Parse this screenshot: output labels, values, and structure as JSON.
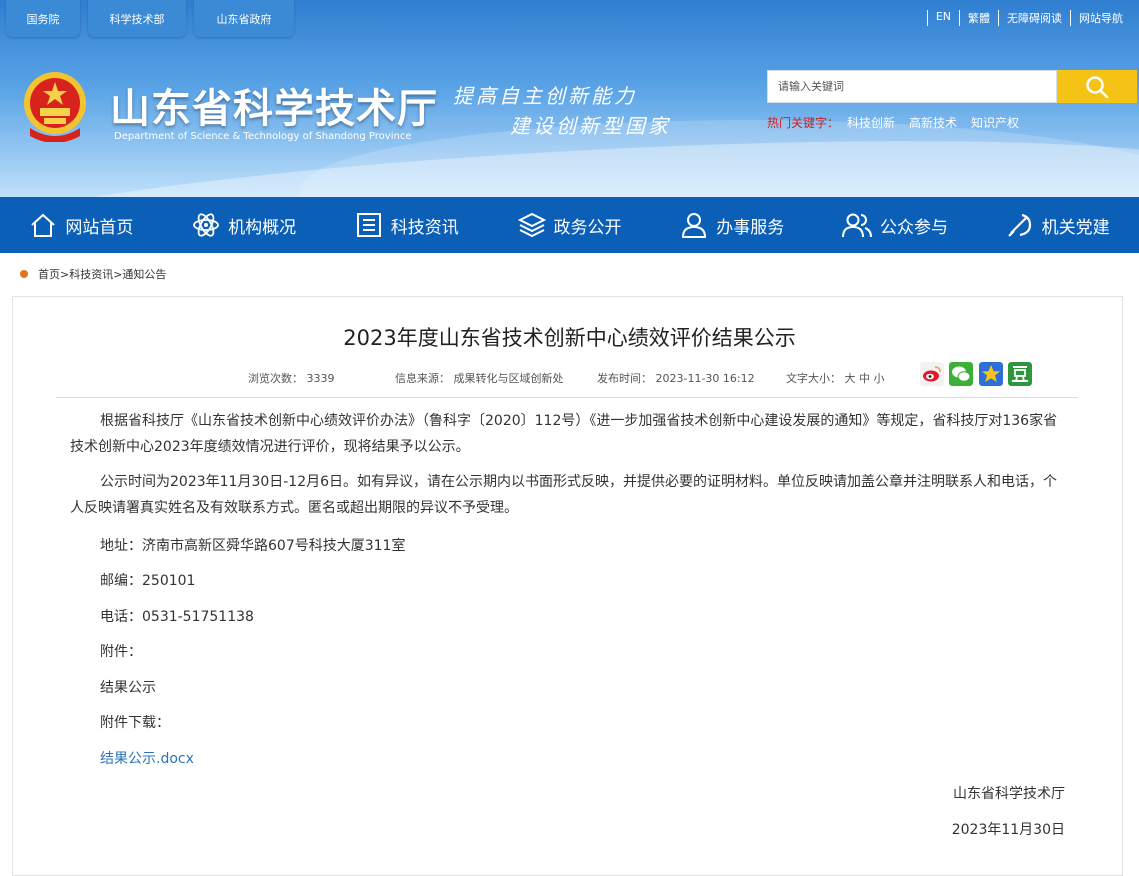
{
  "top_tabs": [
    "国务院",
    "科学技术部",
    "山东省政府"
  ],
  "top_links": [
    "EN",
    "繁體",
    "无障碍阅读",
    "网站导航"
  ],
  "site_title": "山东省科学技术厅",
  "site_subtitle": "Department of Science & Technology of Shandong Province",
  "slogan_line1": "提高自主创新能力",
  "slogan_line2": "建设创新型国家",
  "search": {
    "placeholder": "请输入关键词",
    "icon": "search-icon"
  },
  "hot_keywords": {
    "label": "热门关键字：",
    "items": [
      "科技创新",
      "高新技术",
      "知识产权"
    ]
  },
  "nav": [
    {
      "label": "网站首页",
      "icon": "home-icon"
    },
    {
      "label": "机构概况",
      "icon": "atom-icon"
    },
    {
      "label": "科技资讯",
      "icon": "news-icon"
    },
    {
      "label": "政务公开",
      "icon": "layers-icon"
    },
    {
      "label": "办事服务",
      "icon": "user-icon"
    },
    {
      "label": "公众参与",
      "icon": "people-icon"
    },
    {
      "label": "机关党建",
      "icon": "party-icon"
    }
  ],
  "breadcrumb": "首页>科技资讯>通知公告",
  "article": {
    "title": "2023年度山东省技术创新中心绩效评价结果公示",
    "views": "浏览次数：  3339",
    "source": "信息来源：  成果转化与区域创新处",
    "published": "发布时间：  2023-11-30 16:12",
    "font_size": "文字大小：  大 中 小",
    "share_icons": [
      "weibo-icon",
      "wechat-icon",
      "qzone-icon",
      "douban-icon"
    ],
    "para1": "根据省科技厅《山东省技术创新中心绩效评价办法》（鲁科字〔2020〕112号）《进一步加强省技术创新中心建设发展的通知》等规定，省科技厅对136家省技术创新中心2023年度绩效情况进行评价，现将结果予以公示。",
    "para2": "公示时间为2023年11月30日-12月6日。如有异议，请在公示期内以书面形式反映，并提供必要的证明材料。单位反映请加盖公章并注明联系人和电话，个人反映请署真实姓名及有效联系方式。匿名或超出期限的异议不予受理。",
    "address": "地址：济南市高新区舜华路607号科技大厦311室",
    "postcode": "邮编：250101",
    "phone": "电话：0531-51751138",
    "attachment_label": "附件：",
    "attachment_name": "结果公示",
    "download_label": "附件下载：",
    "download_link": "结果公示.docx",
    "signature": "山东省科学技术厅",
    "date": "2023年11月30日"
  }
}
